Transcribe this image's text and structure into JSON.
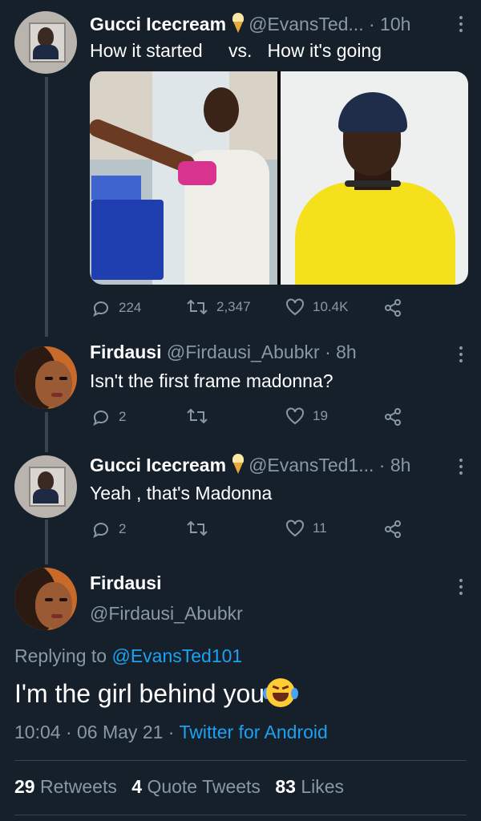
{
  "colors": {
    "background": "#15202b",
    "muted": "#8899a6",
    "link": "#1da1f2",
    "divider": "#38444d"
  },
  "tweets": [
    {
      "name": "Gucci Icecream",
      "name_emoji_icon": "ice-cream-cone-icon",
      "handle": "@EvansTed...",
      "time": "· 10h",
      "text_left": "How it started",
      "text_right": "vs.   How it's going",
      "replies": "224",
      "retweets": "2,347",
      "likes": "10.4K"
    },
    {
      "name": "Firdausi",
      "handle": "@Firdausi_Abubkr",
      "time": "· 8h",
      "text": "Isn't the first frame madonna?",
      "replies": "2",
      "retweets": "",
      "likes": "19"
    },
    {
      "name": "Gucci Icecream",
      "name_emoji_icon": "ice-cream-cone-icon",
      "handle": "@EvansTed1...",
      "time": "· 8h",
      "text": "Yeah , that's Madonna",
      "replies": "2",
      "retweets": "",
      "likes": "11"
    }
  ],
  "main_tweet": {
    "name": "Firdausi",
    "handle": "@Firdausi_Abubkr",
    "replying_prefix": "Replying to ",
    "replying_to": "@EvansTed101",
    "text": "I'm the girl behind you",
    "emoji_icon": "face-with-tears-of-joy-icon",
    "time": "10:04",
    "date": "· 06 May 21 ·",
    "source": "Twitter for Android",
    "retweets_count": "29",
    "retweets_label": "Retweets",
    "quotes_count": "4",
    "quotes_label": "Quote Tweets",
    "likes_count": "83",
    "likes_label": "Likes"
  }
}
